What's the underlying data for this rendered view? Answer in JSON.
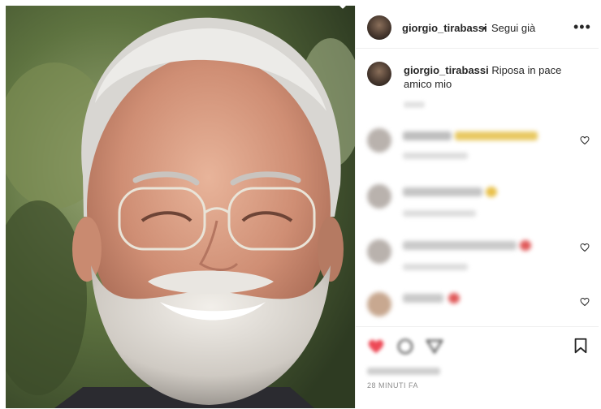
{
  "post": {
    "username": "giorgio_tirabassi",
    "separator": "•",
    "follow_label": "Segui già",
    "more_label": "•••",
    "caption_username": "giorgio_tirabassi",
    "caption_text": " Riposa in pace amico mio",
    "timestamp": "28 MINUTI FA"
  },
  "colors": {
    "like_red": "#ed4956",
    "text": "#262626",
    "muted": "#8e8e8e",
    "border": "#efefef"
  }
}
